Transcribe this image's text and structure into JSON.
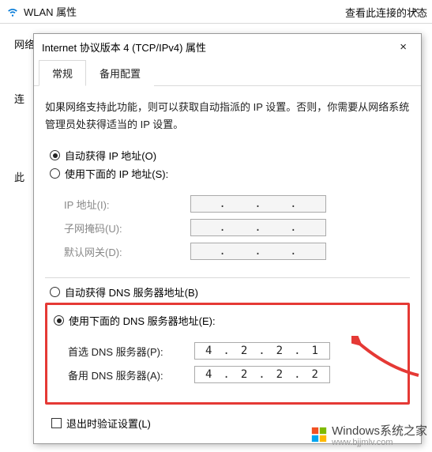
{
  "outer": {
    "title": "WLAN 属性",
    "link_status": "查看此连接的状态",
    "side_net": "网络",
    "side_con": "连",
    "side_this": "此",
    "close": "×"
  },
  "dialog": {
    "title": "Internet 协议版本 4 (TCP/IPv4) 属性",
    "close": "×"
  },
  "tabs": {
    "general": "常规",
    "alt": "备用配置"
  },
  "desc": "如果网络支持此功能，则可以获取自动指派的 IP 设置。否则，你需要从网络系统管理员处获得适当的 IP 设置。",
  "ip_section": {
    "auto": "自动获得 IP 地址(O)",
    "manual": "使用下面的 IP 地址(S):",
    "ip_label": "IP 地址(I):",
    "mask_label": "子网掩码(U):",
    "gw_label": "默认网关(D):",
    "ip_val": "",
    "mask_val": "",
    "gw_val": ""
  },
  "dns_section": {
    "auto": "自动获得 DNS 服务器地址(B)",
    "manual": "使用下面的 DNS 服务器地址(E):",
    "pri_label": "首选 DNS 服务器(P):",
    "alt_label": "备用 DNS 服务器(A):",
    "pri": {
      "a": "4",
      "b": "2",
      "c": "2",
      "d": "1"
    },
    "alt": {
      "a": "4",
      "b": "2",
      "c": "2",
      "d": "2"
    }
  },
  "validate": "退出时验证设置(L)",
  "watermark": {
    "brand": "Windows系统之家",
    "url": "www.bjjmlv.com"
  }
}
